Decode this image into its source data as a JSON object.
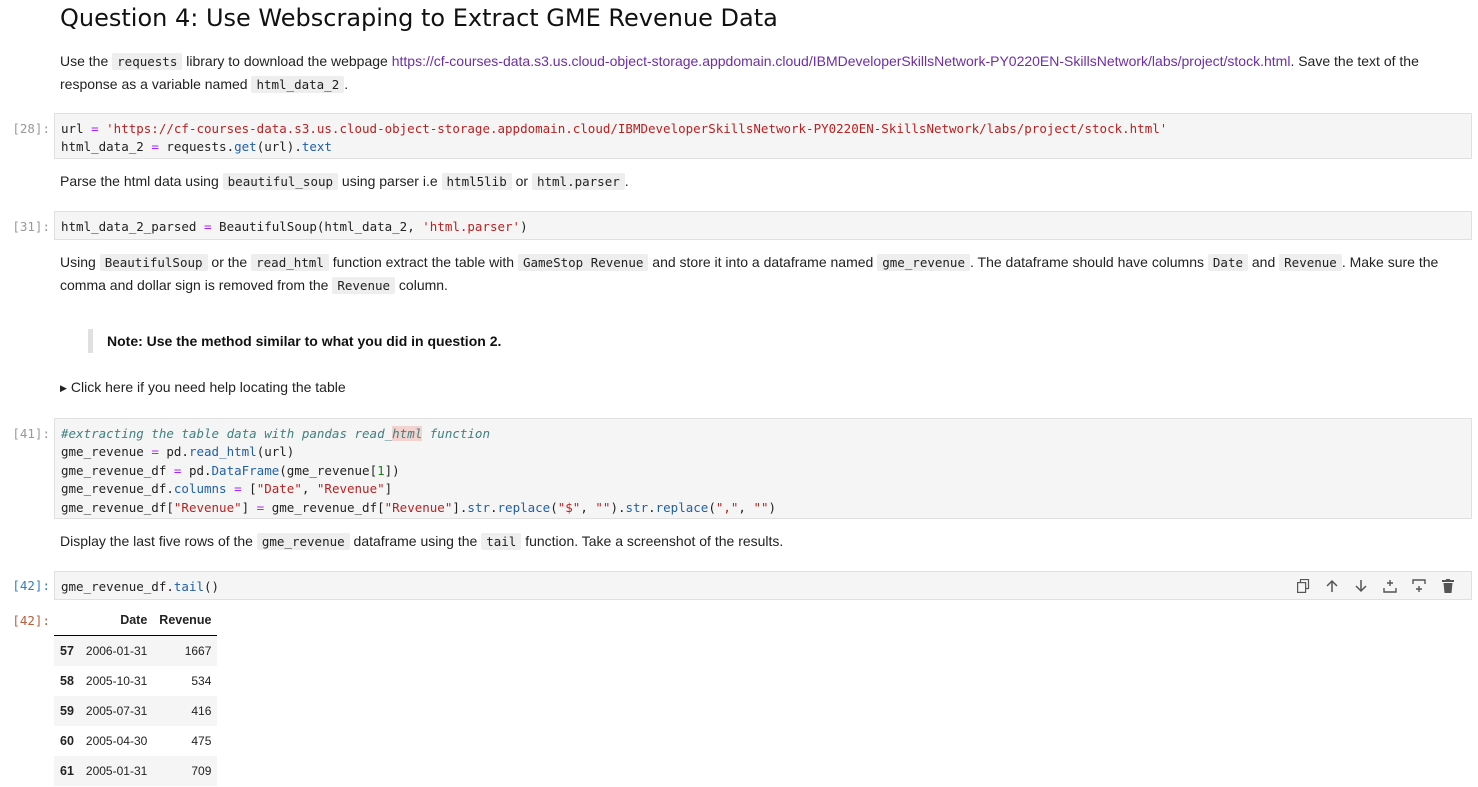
{
  "heading": "Question 4: Use Webscraping to Extract GME Revenue Data",
  "intro": {
    "t1": "Use the ",
    "c1": "requests",
    "t2": " library to download the webpage ",
    "link": "https://cf-courses-data.s3.us.cloud-object-storage.appdomain.cloud/IBMDeveloperSkillsNetwork-PY0220EN-SkillsNetwork/labs/project/stock.html",
    "t3": ". Save the text of the response as a variable named ",
    "c2": "html_data_2",
    "t4": "."
  },
  "cell28": {
    "prompt": "[28]:",
    "line1_var": "url",
    "line1_eq": " = ",
    "line1_str": "'https://cf-courses-data.s3.us.cloud-object-storage.appdomain.cloud/IBMDeveloperSkillsNetwork-PY0220EN-SkillsNetwork/labs/project/stock.html'",
    "line2_a": "html_data_2 ",
    "line2_eq": "=",
    "line2_b": " requests.",
    "line2_get": "get",
    "line2_c": "(url).",
    "line2_text": "text"
  },
  "parse_md": {
    "t1": "Parse the html data using ",
    "c1": "beautiful_soup",
    "t2": " using parser i.e ",
    "c2": "html5lib",
    "t3": " or ",
    "c3": "html.parser",
    "t4": "."
  },
  "cell31": {
    "prompt": "[31]:",
    "a": "html_data_2_parsed ",
    "eq": "=",
    "b": " BeautifulSoup(html_data_2, ",
    "str": "'html.parser'",
    "c": ")"
  },
  "extract_md": {
    "t1": "Using ",
    "c1": "BeautifulSoup",
    "t2": " or the ",
    "c2": "read_html",
    "t3": " function extract the table with ",
    "c3": "GameStop Revenue",
    "t4": " and store it into a dataframe named ",
    "c4": "gme_revenue",
    "t5": ". The dataframe should have columns ",
    "c5": "Date",
    "t6": " and ",
    "c6": "Revenue",
    "t7": ". Make sure the comma and dollar sign is removed from the ",
    "c7": "Revenue",
    "t8": " column."
  },
  "note": "Note: Use the method similar to what you did in question 2.",
  "details_summary": "Click here if you need help locating the table",
  "cell41": {
    "prompt": "[41]:",
    "comment_a": "#extracting the table data with pandas read_",
    "comment_hl": "html",
    "comment_b": " function",
    "l2_a": "gme_revenue ",
    "l2_eq": "=",
    "l2_b": " pd.",
    "l2_fn": "read_html",
    "l2_c": "(url)",
    "l3_a": "gme_revenue_df ",
    "l3_eq": "=",
    "l3_b": " pd.",
    "l3_fn": "DataFrame",
    "l3_c": "(gme_revenue[",
    "l3_num": "1",
    "l3_d": "])",
    "l4_a": "gme_revenue_df.",
    "l4_attr": "columns",
    "l4_eq": " = ",
    "l4_b": "[",
    "l4_s1": "\"Date\"",
    "l4_c": ", ",
    "l4_s2": "\"Revenue\"",
    "l4_d": "]",
    "l5_a": "gme_revenue_df",
    "l5_b": "[",
    "l5_s1": "\"Revenue\"",
    "l5_c": "]",
    "l5_eq": " = ",
    "l5_d": "gme_revenue_df",
    "l5_e": "[",
    "l5_s2": "\"Revenue\"",
    "l5_f": "].",
    "l5_str1": "str",
    "l5_g": ".",
    "l5_rep1": "replace",
    "l5_h": "(",
    "l5_s3": "\"$\"",
    "l5_i": ", ",
    "l5_s4": "\"\"",
    "l5_j": ").",
    "l5_str2": "str",
    "l5_k": ".",
    "l5_rep2": "replace",
    "l5_l": "(",
    "l5_s5": "\",\"",
    "l5_m": ", ",
    "l5_s6": "\"\"",
    "l5_n": ")"
  },
  "display_md": {
    "t1": "Display the last five rows of the ",
    "c1": "gme_revenue",
    "t2": " dataframe using the ",
    "c2": "tail",
    "t3": " function. Take a screenshot of the results."
  },
  "cell42": {
    "prompt": "[42]:",
    "a": "gme_revenue_df.",
    "fn": "tail",
    "b": "()",
    "toolbar": [
      "copy-icon",
      "move-up-icon",
      "move-down-icon",
      "insert-above-icon",
      "insert-below-icon",
      "delete-icon"
    ]
  },
  "output42": {
    "prompt": "[42]:",
    "columns": [
      "",
      "Date",
      "Revenue"
    ],
    "rows": [
      {
        "index": "57",
        "date": "2006-01-31",
        "revenue": "1667"
      },
      {
        "index": "58",
        "date": "2005-10-31",
        "revenue": "534"
      },
      {
        "index": "59",
        "date": "2005-07-31",
        "revenue": "416"
      },
      {
        "index": "60",
        "date": "2005-04-30",
        "revenue": "475"
      },
      {
        "index": "61",
        "date": "2005-01-31",
        "revenue": "709"
      }
    ]
  },
  "colors": {
    "link": "#6f2da8",
    "string": "#ba2121",
    "prompt_current": "#307fc1",
    "prompt_output": "#bf5b3d"
  }
}
